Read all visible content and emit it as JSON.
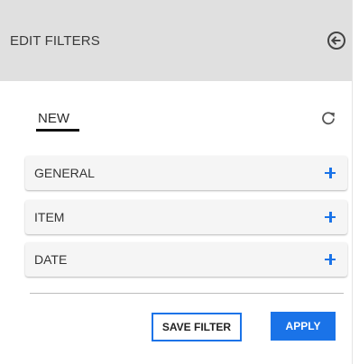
{
  "header": {
    "title": "EDIT FILTERS",
    "back_icon": "arrow-left-circle-icon"
  },
  "tab": {
    "label": "NEW",
    "refresh_icon": "refresh-icon"
  },
  "sections": [
    {
      "label": "GENERAL",
      "icon": "plus-icon"
    },
    {
      "label": "ITEM",
      "icon": "plus-icon"
    },
    {
      "label": "DATE",
      "icon": "plus-icon"
    }
  ],
  "actions": {
    "save_label": "SAVE FILTER",
    "apply_label": "APPLY"
  },
  "colors": {
    "accent": "#1a73e8",
    "header_bg": "#e0e0e0",
    "section_bg": "#f5f5f5"
  }
}
